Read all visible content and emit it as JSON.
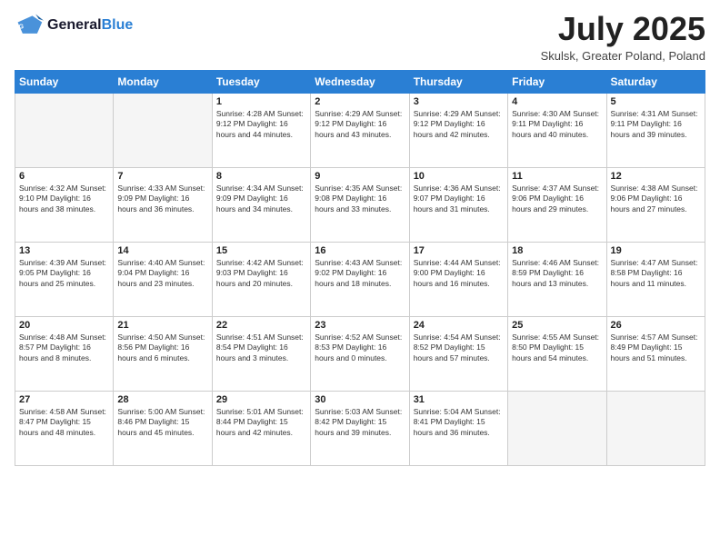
{
  "header": {
    "logo_general": "General",
    "logo_blue": "Blue",
    "month_title": "July 2025",
    "location": "Skulsk, Greater Poland, Poland"
  },
  "days_of_week": [
    "Sunday",
    "Monday",
    "Tuesday",
    "Wednesday",
    "Thursday",
    "Friday",
    "Saturday"
  ],
  "weeks": [
    [
      {
        "day": "",
        "info": ""
      },
      {
        "day": "",
        "info": ""
      },
      {
        "day": "1",
        "info": "Sunrise: 4:28 AM\nSunset: 9:12 PM\nDaylight: 16 hours and 44 minutes."
      },
      {
        "day": "2",
        "info": "Sunrise: 4:29 AM\nSunset: 9:12 PM\nDaylight: 16 hours and 43 minutes."
      },
      {
        "day": "3",
        "info": "Sunrise: 4:29 AM\nSunset: 9:12 PM\nDaylight: 16 hours and 42 minutes."
      },
      {
        "day": "4",
        "info": "Sunrise: 4:30 AM\nSunset: 9:11 PM\nDaylight: 16 hours and 40 minutes."
      },
      {
        "day": "5",
        "info": "Sunrise: 4:31 AM\nSunset: 9:11 PM\nDaylight: 16 hours and 39 minutes."
      }
    ],
    [
      {
        "day": "6",
        "info": "Sunrise: 4:32 AM\nSunset: 9:10 PM\nDaylight: 16 hours and 38 minutes."
      },
      {
        "day": "7",
        "info": "Sunrise: 4:33 AM\nSunset: 9:09 PM\nDaylight: 16 hours and 36 minutes."
      },
      {
        "day": "8",
        "info": "Sunrise: 4:34 AM\nSunset: 9:09 PM\nDaylight: 16 hours and 34 minutes."
      },
      {
        "day": "9",
        "info": "Sunrise: 4:35 AM\nSunset: 9:08 PM\nDaylight: 16 hours and 33 minutes."
      },
      {
        "day": "10",
        "info": "Sunrise: 4:36 AM\nSunset: 9:07 PM\nDaylight: 16 hours and 31 minutes."
      },
      {
        "day": "11",
        "info": "Sunrise: 4:37 AM\nSunset: 9:06 PM\nDaylight: 16 hours and 29 minutes."
      },
      {
        "day": "12",
        "info": "Sunrise: 4:38 AM\nSunset: 9:06 PM\nDaylight: 16 hours and 27 minutes."
      }
    ],
    [
      {
        "day": "13",
        "info": "Sunrise: 4:39 AM\nSunset: 9:05 PM\nDaylight: 16 hours and 25 minutes."
      },
      {
        "day": "14",
        "info": "Sunrise: 4:40 AM\nSunset: 9:04 PM\nDaylight: 16 hours and 23 minutes."
      },
      {
        "day": "15",
        "info": "Sunrise: 4:42 AM\nSunset: 9:03 PM\nDaylight: 16 hours and 20 minutes."
      },
      {
        "day": "16",
        "info": "Sunrise: 4:43 AM\nSunset: 9:02 PM\nDaylight: 16 hours and 18 minutes."
      },
      {
        "day": "17",
        "info": "Sunrise: 4:44 AM\nSunset: 9:00 PM\nDaylight: 16 hours and 16 minutes."
      },
      {
        "day": "18",
        "info": "Sunrise: 4:46 AM\nSunset: 8:59 PM\nDaylight: 16 hours and 13 minutes."
      },
      {
        "day": "19",
        "info": "Sunrise: 4:47 AM\nSunset: 8:58 PM\nDaylight: 16 hours and 11 minutes."
      }
    ],
    [
      {
        "day": "20",
        "info": "Sunrise: 4:48 AM\nSunset: 8:57 PM\nDaylight: 16 hours and 8 minutes."
      },
      {
        "day": "21",
        "info": "Sunrise: 4:50 AM\nSunset: 8:56 PM\nDaylight: 16 hours and 6 minutes."
      },
      {
        "day": "22",
        "info": "Sunrise: 4:51 AM\nSunset: 8:54 PM\nDaylight: 16 hours and 3 minutes."
      },
      {
        "day": "23",
        "info": "Sunrise: 4:52 AM\nSunset: 8:53 PM\nDaylight: 16 hours and 0 minutes."
      },
      {
        "day": "24",
        "info": "Sunrise: 4:54 AM\nSunset: 8:52 PM\nDaylight: 15 hours and 57 minutes."
      },
      {
        "day": "25",
        "info": "Sunrise: 4:55 AM\nSunset: 8:50 PM\nDaylight: 15 hours and 54 minutes."
      },
      {
        "day": "26",
        "info": "Sunrise: 4:57 AM\nSunset: 8:49 PM\nDaylight: 15 hours and 51 minutes."
      }
    ],
    [
      {
        "day": "27",
        "info": "Sunrise: 4:58 AM\nSunset: 8:47 PM\nDaylight: 15 hours and 48 minutes."
      },
      {
        "day": "28",
        "info": "Sunrise: 5:00 AM\nSunset: 8:46 PM\nDaylight: 15 hours and 45 minutes."
      },
      {
        "day": "29",
        "info": "Sunrise: 5:01 AM\nSunset: 8:44 PM\nDaylight: 15 hours and 42 minutes."
      },
      {
        "day": "30",
        "info": "Sunrise: 5:03 AM\nSunset: 8:42 PM\nDaylight: 15 hours and 39 minutes."
      },
      {
        "day": "31",
        "info": "Sunrise: 5:04 AM\nSunset: 8:41 PM\nDaylight: 15 hours and 36 minutes."
      },
      {
        "day": "",
        "info": ""
      },
      {
        "day": "",
        "info": ""
      }
    ]
  ]
}
